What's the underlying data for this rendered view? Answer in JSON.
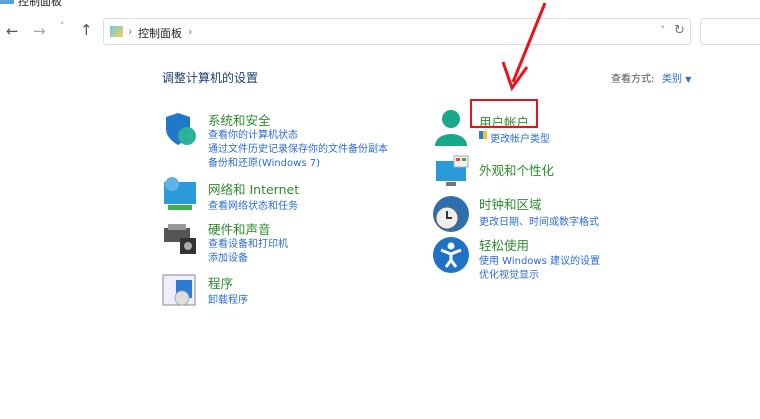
{
  "window": {
    "title": "控制面板"
  },
  "address": {
    "crumb": "控制面板"
  },
  "heading": "调整计算机的设置",
  "view": {
    "label": "查看方式:",
    "value": "类别"
  },
  "left": [
    {
      "title": "系统和安全",
      "links": [
        "查看你的计算机状态",
        "通过文件历史记录保存你的文件备份副本",
        "备份和还原(Windows 7)"
      ]
    },
    {
      "title": "网络和 Internet",
      "links": [
        "查看网络状态和任务"
      ]
    },
    {
      "title": "硬件和声音",
      "links": [
        "查看设备和打印机",
        "添加设备"
      ]
    },
    {
      "title": "程序",
      "links": [
        "卸载程序"
      ]
    }
  ],
  "right": [
    {
      "title": "用户帐户",
      "links": [
        "更改帐户类型"
      ]
    },
    {
      "title": "外观和个性化",
      "links": []
    },
    {
      "title": "时钟和区域",
      "links": [
        "更改日期、时间或数字格式"
      ]
    },
    {
      "title": "轻松使用",
      "links": [
        "使用 Windows 建议的设置",
        "优化视觉显示"
      ]
    }
  ],
  "colors": {
    "highlight": "#e8141c",
    "title": "#2e8b2e",
    "link": "#2b6cd6"
  }
}
